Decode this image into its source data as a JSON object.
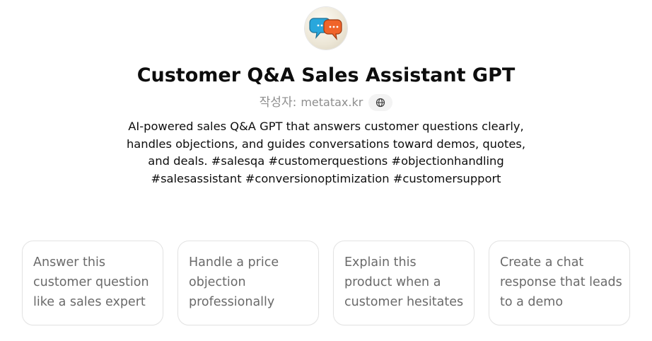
{
  "gpt": {
    "title": "Customer Q&A Sales Assistant GPT",
    "author_prefix": "작성자:",
    "author_name": "metatax.kr",
    "author_link_icon": "globe-icon",
    "avatar_icon": "speech-bubbles-icon",
    "description": "AI-powered sales Q&A GPT that answers customer questions clearly, handles objections, and guides conversations toward demos, quotes, and deals. #salesqa #customerquestions #objectionhandling #salesassistant #conversionoptimization #customersupport"
  },
  "conversation_starters": [
    {
      "label": "Answer this customer question like a sales expert"
    },
    {
      "label": "Handle a price objection professionally"
    },
    {
      "label": "Explain this product when a customer hesitates"
    },
    {
      "label": "Create a chat response that leads to a demo"
    }
  ],
  "colors": {
    "title_text": "#0d0d0d",
    "muted_text": "#8e8e8e",
    "card_text": "#6a6a6a",
    "card_border": "#e3e3e3",
    "bubble_blue": "#29a7dc",
    "bubble_orange": "#f0642a"
  }
}
